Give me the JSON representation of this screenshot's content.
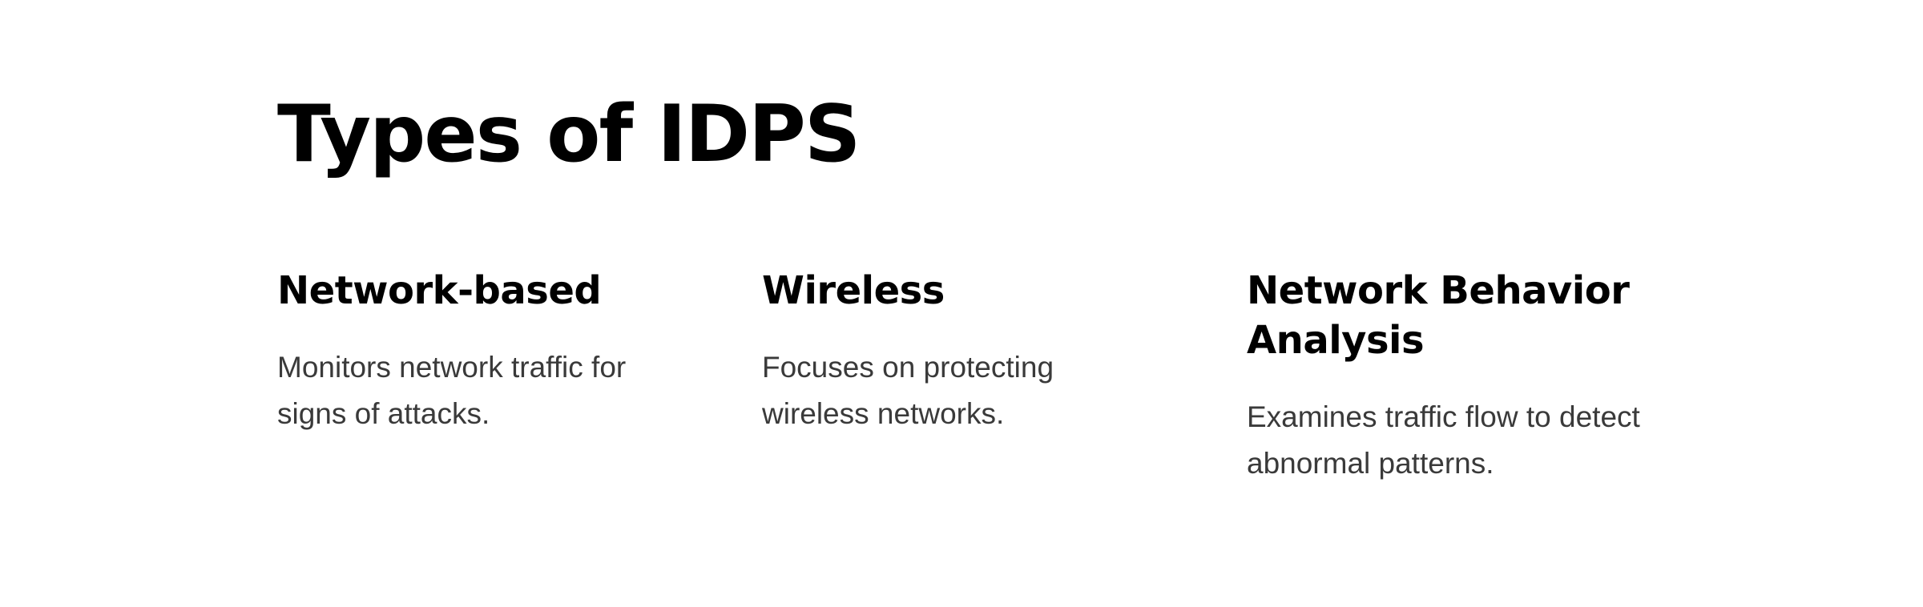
{
  "page": {
    "title": "Types of IDPS"
  },
  "cards": [
    {
      "title": "Network-based",
      "description": "Monitors network traffic for signs of attacks."
    },
    {
      "title": "Wireless",
      "description": "Focuses on protecting wireless networks."
    },
    {
      "title": "Network Behavior Analysis",
      "description": "Examines traffic flow to detect abnormal patterns."
    }
  ],
  "colors": {
    "background": "#ffffff",
    "heading": "#000000",
    "body_text": "#3a3a3a"
  }
}
